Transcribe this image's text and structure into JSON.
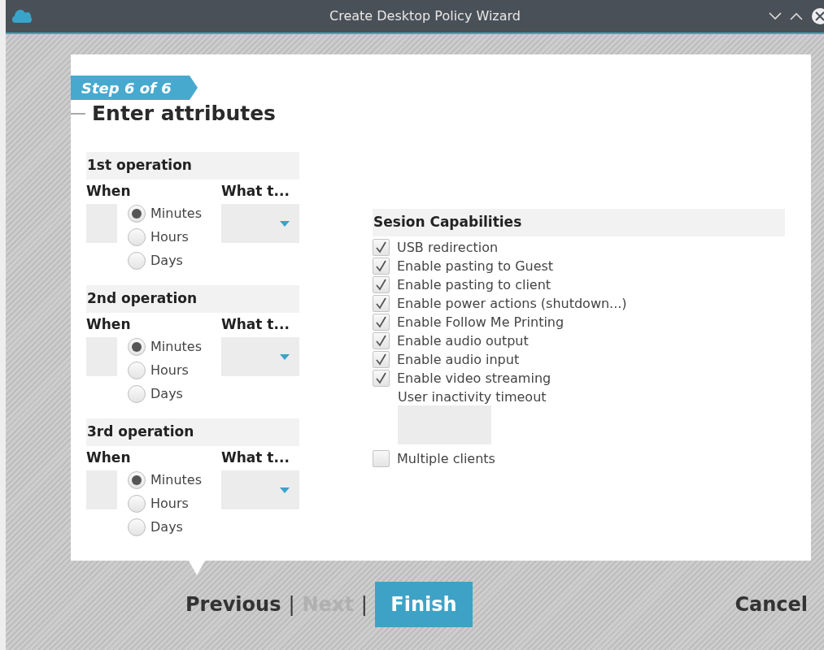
{
  "window": {
    "title": "Create Desktop Policy Wizard"
  },
  "step": "Step 6 of 6",
  "heading": "Enter attributes",
  "operations": [
    {
      "title": "1st operation",
      "when_label": "When",
      "what_label": "What t...",
      "units": [
        {
          "label": "Minutes",
          "selected": true
        },
        {
          "label": "Hours",
          "selected": false
        },
        {
          "label": "Days",
          "selected": false
        }
      ]
    },
    {
      "title": "2nd operation",
      "when_label": "When",
      "what_label": "What t...",
      "units": [
        {
          "label": "Minutes",
          "selected": true
        },
        {
          "label": "Hours",
          "selected": false
        },
        {
          "label": "Days",
          "selected": false
        }
      ]
    },
    {
      "title": "3rd operation",
      "when_label": "When",
      "what_label": "What t...",
      "units": [
        {
          "label": "Minutes",
          "selected": true
        },
        {
          "label": "Hours",
          "selected": false
        },
        {
          "label": "Days",
          "selected": false
        }
      ]
    }
  ],
  "capabilities": {
    "title": "Sesion Capabilities",
    "items": [
      {
        "kind": "checkbox",
        "label": "USB redirection",
        "checked": true
      },
      {
        "kind": "checkbox",
        "label": "Enable pasting to Guest",
        "checked": true
      },
      {
        "kind": "checkbox",
        "label": "Enable pasting to client",
        "checked": true
      },
      {
        "kind": "checkbox",
        "label": "Enable power actions (shutdown...)",
        "checked": true
      },
      {
        "kind": "checkbox",
        "label": "Enable Follow Me Printing",
        "checked": true
      },
      {
        "kind": "checkbox",
        "label": "Enable audio output",
        "checked": true
      },
      {
        "kind": "checkbox",
        "label": "Enable audio input",
        "checked": true
      },
      {
        "kind": "checkbox",
        "label": "Enable video streaming",
        "checked": true
      },
      {
        "kind": "field",
        "label": "User inactivity timeout"
      },
      {
        "kind": "checkbox",
        "label": "Multiple clients",
        "checked": false
      }
    ]
  },
  "footer": [
    {
      "kind": "link",
      "label": "Previous",
      "disabled": false
    },
    {
      "kind": "separator",
      "label": "|"
    },
    {
      "kind": "link",
      "label": "Next",
      "disabled": true
    },
    {
      "kind": "separator",
      "label": "|"
    },
    {
      "kind": "primary",
      "label": "Finish",
      "disabled": false
    },
    {
      "kind": "cancel",
      "label": "Cancel",
      "disabled": false
    }
  ]
}
